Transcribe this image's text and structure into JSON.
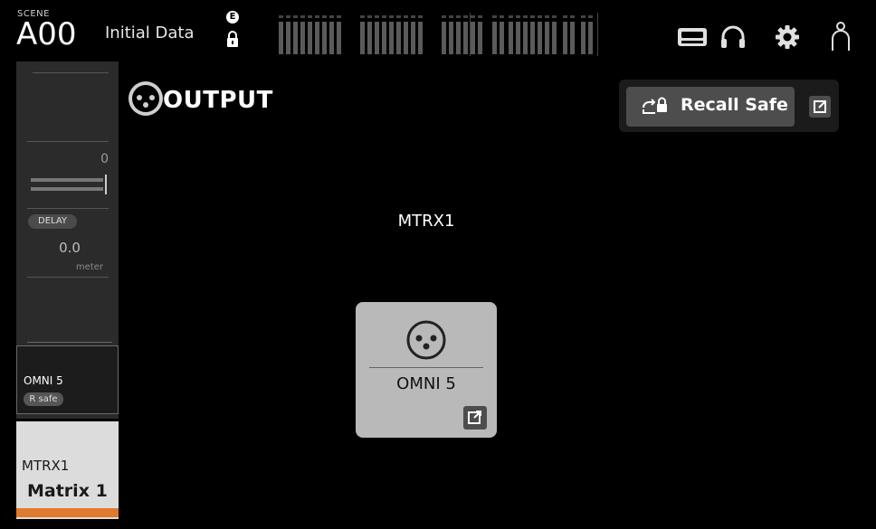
{
  "scene": {
    "label": "SCENE",
    "number": "A00",
    "name": "Initial Data",
    "edited_badge": "E"
  },
  "toolbar": {
    "icons": [
      "tape-icon",
      "headphones-icon",
      "gear-icon",
      "user-icon"
    ]
  },
  "channel_strip": {
    "level": "0",
    "delay_label": "DELAY",
    "delay_value": "0.0",
    "delay_unit": "meter",
    "port_name": "OMNI 5",
    "recall_safe_badge": "R safe",
    "channel_short": "MTRX1",
    "channel_name": "Matrix 1",
    "channel_color": "#e07a2e"
  },
  "page": {
    "title": "OUTPUT",
    "recall_safe_label": "Recall Safe"
  },
  "output": {
    "channel": "MTRX1",
    "port_name": "OMNI 5"
  },
  "colors": {
    "accent_orange": "#e07a2e",
    "card_gray": "#b9b9b9"
  }
}
